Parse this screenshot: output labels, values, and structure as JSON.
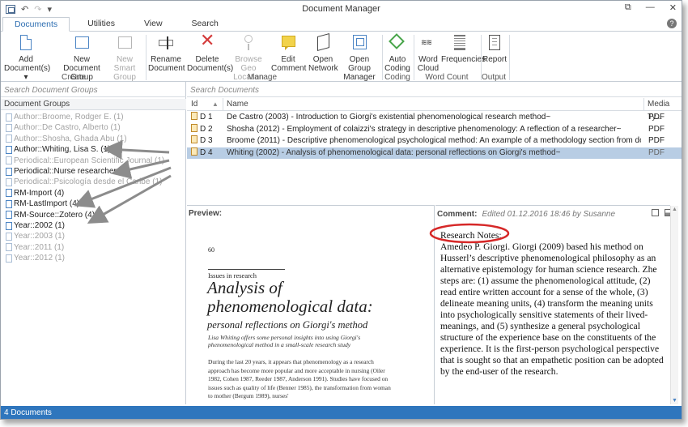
{
  "window": {
    "title": "Document Manager",
    "quick_access": {
      "undo": "↶",
      "dropdown": "▾"
    },
    "controls": {
      "restore": "⧉",
      "minimize": "—",
      "close": "✕"
    }
  },
  "ribbon_tabs": [
    "Documents",
    "Utilities",
    "View",
    "Search"
  ],
  "help_label": "?",
  "ribbon": {
    "add_documents": "Add Document(s) ▾",
    "new_document_group": "New Document Group",
    "new_smart_group": "New Smart Group",
    "rename_document": "Rename Document",
    "delete_documents": "Delete Document(s)",
    "browse_geo_location": "Browse Geo Location",
    "edit_comment": "Edit Comment",
    "open_network": "Open Network",
    "open_group_manager": "Open Group Manager",
    "auto_coding": "Auto Coding",
    "word_cloud": "Word Cloud",
    "frequencies": "Frequencies",
    "report": "Report",
    "groups": {
      "create": "Create",
      "manage": "Manage",
      "coding": "Coding",
      "word_count": "Word Count",
      "output": "Output"
    }
  },
  "search": {
    "groups_placeholder": "Search Document Groups",
    "documents_placeholder": "Search Documents"
  },
  "document_groups": {
    "header": "Document Groups",
    "items": [
      {
        "label": "Author::Broome, Rodger E. (1)",
        "active": false
      },
      {
        "label": "Author::De Castro, Alberto (1)",
        "active": false
      },
      {
        "label": "Author::Shosha, Ghada Abu (1)",
        "active": false
      },
      {
        "label": "Author::Whiting, Lisa S. (1)",
        "active": true
      },
      {
        "label": "Periodical::European Scientific Journal (1)",
        "active": false
      },
      {
        "label": "Periodical::Nurse researcher (1)",
        "active": true
      },
      {
        "label": "Periodical::Psicología desde el Caribe (1)",
        "active": false
      },
      {
        "label": "RM-Import (4)",
        "active": true
      },
      {
        "label": "RM-LastImport (4)",
        "active": true
      },
      {
        "label": "RM-Source::Zotero (4)",
        "active": true
      },
      {
        "label": "Year::2002 (1)",
        "active": true
      },
      {
        "label": "Year::2003 (1)",
        "active": false
      },
      {
        "label": "Year::2011 (1)",
        "active": false
      },
      {
        "label": "Year::2012 (1)",
        "active": false
      }
    ]
  },
  "documents": {
    "columns": {
      "id": "Id",
      "sort": "▲",
      "name": "Name",
      "media_type": "Media Ty..."
    },
    "rows": [
      {
        "id": "D 1",
        "name": "De Castro (2003) - Introduction to Giorgi's existential phenomenological research method~",
        "media": "PDF"
      },
      {
        "id": "D 2",
        "name": "Shosha (2012) - Employment of colaizzi's strategy in descriptive phenomenology: A reflection of a researcher~",
        "media": "PDF"
      },
      {
        "id": "D 3",
        "name": "Broome (2011) - Descriptive phenomenological psychological method: An example of a methodology section from doctoral dissertation~",
        "media": "PDF"
      },
      {
        "id": "D 4",
        "name": "Whiting (2002) - Analysis of phenomenological data: personal reflections on Giorgi's method~",
        "media": "PDF"
      }
    ]
  },
  "preview": {
    "label": "Preview:",
    "page_number": "60",
    "section": "Issues in research",
    "title": "Analysis of phenomenological data:",
    "subtitle": "personal reflections on Giorgi's method",
    "lede": "Lisa Whiting offers some personal insights into using Giorgi's phenomenological method in a small-scale research study",
    "body": "During the last 20 years, it appears that phenomenology as a research approach has become more popular and more acceptable in nursing (Oiler 1982, Cohen 1987, Reeder 1987, Anderson 1991). Studies have focused on issues such as quality of life (Benner 1985), the transformation from woman to mother (Bergum 1989), nurses'"
  },
  "comment": {
    "label": "Comment:",
    "meta": "Edited 01.12.2016 18:46 by Susanne",
    "heading": "Research Notes:",
    "body": "Amedeo P. Giorgi. Giorgi (2009) based his method on Husserl’s descriptive phenomenological philosophy as an alternative epistemology for human science research. Zhe steps are: (1) assume the phenomenological attitude, (2) read entire written account for a sense of the whole, (3) delineate meaning units, (4) transform the meaning units into psychologically sensitive statements of their lived-meanings, and (5) synthesize a general psychological structure of the experience base on the constituents of the experience. It is the first-person psychological perspective that is sought so that an empathetic position can be adopted by the end-user of the research."
  },
  "status": {
    "text": "4 Documents"
  },
  "colors": {
    "accent": "#2f76bd",
    "selection": "#b8cde4",
    "annotation": "#d62828"
  }
}
